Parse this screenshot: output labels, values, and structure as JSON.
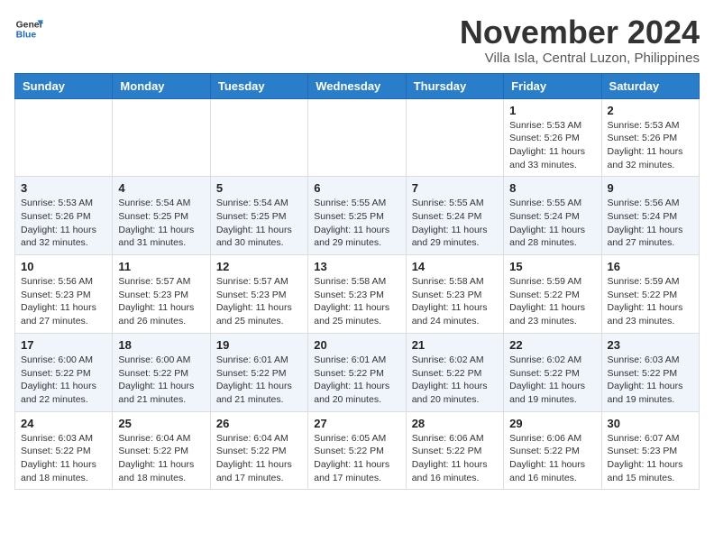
{
  "header": {
    "logo_line1": "General",
    "logo_line2": "Blue",
    "month": "November 2024",
    "location": "Villa Isla, Central Luzon, Philippines"
  },
  "weekdays": [
    "Sunday",
    "Monday",
    "Tuesday",
    "Wednesday",
    "Thursday",
    "Friday",
    "Saturday"
  ],
  "weeks": [
    [
      {
        "day": "",
        "info": ""
      },
      {
        "day": "",
        "info": ""
      },
      {
        "day": "",
        "info": ""
      },
      {
        "day": "",
        "info": ""
      },
      {
        "day": "",
        "info": ""
      },
      {
        "day": "1",
        "info": "Sunrise: 5:53 AM\nSunset: 5:26 PM\nDaylight: 11 hours\nand 33 minutes."
      },
      {
        "day": "2",
        "info": "Sunrise: 5:53 AM\nSunset: 5:26 PM\nDaylight: 11 hours\nand 32 minutes."
      }
    ],
    [
      {
        "day": "3",
        "info": "Sunrise: 5:53 AM\nSunset: 5:26 PM\nDaylight: 11 hours\nand 32 minutes."
      },
      {
        "day": "4",
        "info": "Sunrise: 5:54 AM\nSunset: 5:25 PM\nDaylight: 11 hours\nand 31 minutes."
      },
      {
        "day": "5",
        "info": "Sunrise: 5:54 AM\nSunset: 5:25 PM\nDaylight: 11 hours\nand 30 minutes."
      },
      {
        "day": "6",
        "info": "Sunrise: 5:55 AM\nSunset: 5:25 PM\nDaylight: 11 hours\nand 29 minutes."
      },
      {
        "day": "7",
        "info": "Sunrise: 5:55 AM\nSunset: 5:24 PM\nDaylight: 11 hours\nand 29 minutes."
      },
      {
        "day": "8",
        "info": "Sunrise: 5:55 AM\nSunset: 5:24 PM\nDaylight: 11 hours\nand 28 minutes."
      },
      {
        "day": "9",
        "info": "Sunrise: 5:56 AM\nSunset: 5:24 PM\nDaylight: 11 hours\nand 27 minutes."
      }
    ],
    [
      {
        "day": "10",
        "info": "Sunrise: 5:56 AM\nSunset: 5:23 PM\nDaylight: 11 hours\nand 27 minutes."
      },
      {
        "day": "11",
        "info": "Sunrise: 5:57 AM\nSunset: 5:23 PM\nDaylight: 11 hours\nand 26 minutes."
      },
      {
        "day": "12",
        "info": "Sunrise: 5:57 AM\nSunset: 5:23 PM\nDaylight: 11 hours\nand 25 minutes."
      },
      {
        "day": "13",
        "info": "Sunrise: 5:58 AM\nSunset: 5:23 PM\nDaylight: 11 hours\nand 25 minutes."
      },
      {
        "day": "14",
        "info": "Sunrise: 5:58 AM\nSunset: 5:23 PM\nDaylight: 11 hours\nand 24 minutes."
      },
      {
        "day": "15",
        "info": "Sunrise: 5:59 AM\nSunset: 5:22 PM\nDaylight: 11 hours\nand 23 minutes."
      },
      {
        "day": "16",
        "info": "Sunrise: 5:59 AM\nSunset: 5:22 PM\nDaylight: 11 hours\nand 23 minutes."
      }
    ],
    [
      {
        "day": "17",
        "info": "Sunrise: 6:00 AM\nSunset: 5:22 PM\nDaylight: 11 hours\nand 22 minutes."
      },
      {
        "day": "18",
        "info": "Sunrise: 6:00 AM\nSunset: 5:22 PM\nDaylight: 11 hours\nand 21 minutes."
      },
      {
        "day": "19",
        "info": "Sunrise: 6:01 AM\nSunset: 5:22 PM\nDaylight: 11 hours\nand 21 minutes."
      },
      {
        "day": "20",
        "info": "Sunrise: 6:01 AM\nSunset: 5:22 PM\nDaylight: 11 hours\nand 20 minutes."
      },
      {
        "day": "21",
        "info": "Sunrise: 6:02 AM\nSunset: 5:22 PM\nDaylight: 11 hours\nand 20 minutes."
      },
      {
        "day": "22",
        "info": "Sunrise: 6:02 AM\nSunset: 5:22 PM\nDaylight: 11 hours\nand 19 minutes."
      },
      {
        "day": "23",
        "info": "Sunrise: 6:03 AM\nSunset: 5:22 PM\nDaylight: 11 hours\nand 19 minutes."
      }
    ],
    [
      {
        "day": "24",
        "info": "Sunrise: 6:03 AM\nSunset: 5:22 PM\nDaylight: 11 hours\nand 18 minutes."
      },
      {
        "day": "25",
        "info": "Sunrise: 6:04 AM\nSunset: 5:22 PM\nDaylight: 11 hours\nand 18 minutes."
      },
      {
        "day": "26",
        "info": "Sunrise: 6:04 AM\nSunset: 5:22 PM\nDaylight: 11 hours\nand 17 minutes."
      },
      {
        "day": "27",
        "info": "Sunrise: 6:05 AM\nSunset: 5:22 PM\nDaylight: 11 hours\nand 17 minutes."
      },
      {
        "day": "28",
        "info": "Sunrise: 6:06 AM\nSunset: 5:22 PM\nDaylight: 11 hours\nand 16 minutes."
      },
      {
        "day": "29",
        "info": "Sunrise: 6:06 AM\nSunset: 5:22 PM\nDaylight: 11 hours\nand 16 minutes."
      },
      {
        "day": "30",
        "info": "Sunrise: 6:07 AM\nSunset: 5:23 PM\nDaylight: 11 hours\nand 15 minutes."
      }
    ]
  ]
}
